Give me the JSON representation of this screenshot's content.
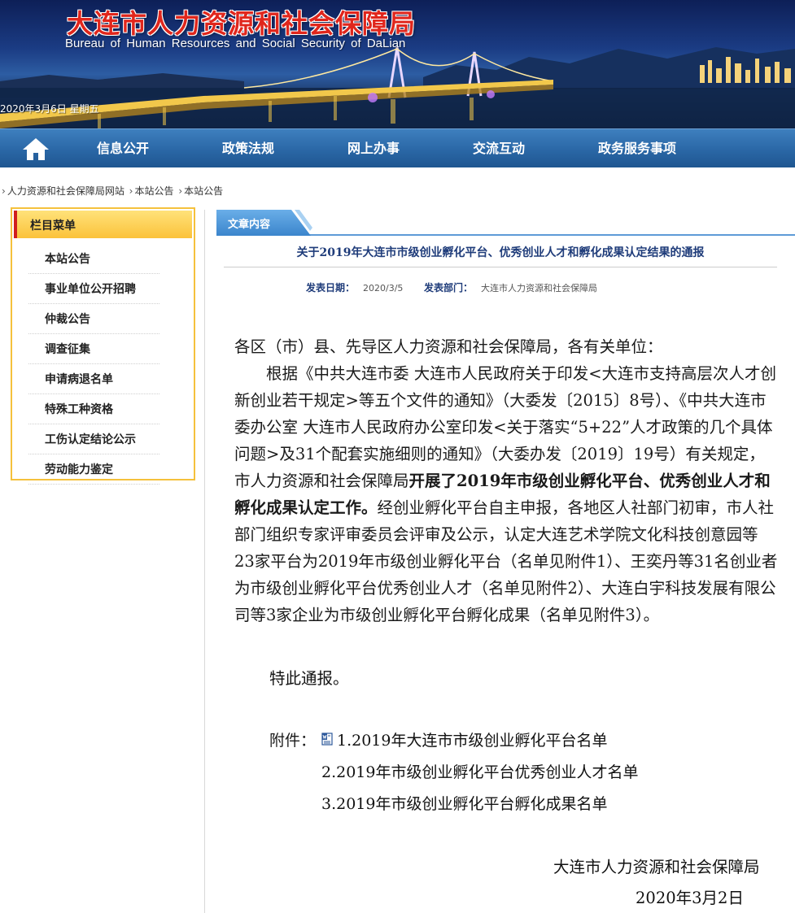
{
  "header": {
    "title": "大连市人力资源和社会保障局",
    "subtitle": "Bureau  of  Human Resources  and  Social Security  of  DaLian",
    "date_line": "2020年3月6日 星期五"
  },
  "nav": {
    "home_icon": "home-icon",
    "items": [
      {
        "label": "信息公开"
      },
      {
        "label": "政策法规"
      },
      {
        "label": "网上办事"
      },
      {
        "label": "交流互动"
      },
      {
        "label": "政务服务事项"
      }
    ]
  },
  "breadcrumb": {
    "items": [
      "人力资源和社会保障局网站",
      "本站公告",
      "本站公告"
    ]
  },
  "sidebar": {
    "heading": "栏目菜单",
    "items": [
      {
        "label": "本站公告"
      },
      {
        "label": "事业单位公开招聘"
      },
      {
        "label": "仲裁公告"
      },
      {
        "label": "调查征集"
      },
      {
        "label": "申请病退名单"
      },
      {
        "label": "特殊工种资格"
      },
      {
        "label": "工伤认定结论公示"
      },
      {
        "label": "劳动能力鉴定"
      }
    ]
  },
  "article": {
    "tab_label": "文章内容",
    "title": "关于2019年大连市市级创业孵化平台、优秀创业人才和孵化成果认定结果的通报",
    "publish_date_label": "发表日期：",
    "publish_date": "2020/3/5",
    "dept_label": "发表部门：",
    "dept": "大连市人力资源和社会保障局",
    "salutation": "各区（市）县、先导区人力资源和社会保障局，各有关单位：",
    "body_part1": "根据《中共大连市委 大连市人民政府关于印发<大连市支持高层次人才创新创业若干规定>等五个文件的通知》（大委发〔2015〕8号）、《中共大连市委办公室 大连市人民政府办公室印发<关于落实“5+22”人才政策的几个具体问题>及31个配套实施细则的通知》（大委办发〔2019〕19号）有关规定，市人力资源和社会保障局",
    "body_bold": "开展了2019年市级创业孵化平台、优秀创业人才和孵化成果认定工作。",
    "body_part2": "经创业孵化平台自主申报，各地区人社部门初审，市人社部门组织专家评审委员会评审及公示，认定大连艺术学院文化科技创意园等23家平台为2019年市级创业孵化平台（名单见附件1）、王奕丹等31名创业者为市级创业孵化平台优秀创业人才（名单见附件2）、大连白宇科技发展有限公司等3家企业为市级创业孵化平台孵化成果（名单见附件3）。",
    "closing": "特此通报。",
    "attachments_label": "附件：",
    "attachments": [
      "1.2019年大连市市级创业孵化平台名单",
      "2.2019年市级创业孵化平台优秀创业人才名单",
      "3.2019年市级创业孵化平台孵化成果名单"
    ],
    "sign_org": "大连市人力资源和社会保障局",
    "sign_date": "2020年3月2日"
  },
  "colors": {
    "title_red": "#e0261c",
    "nav_blue": "#2a67a6",
    "menu_gold": "#f5c13c",
    "heading_navy": "#1f3c7a"
  }
}
